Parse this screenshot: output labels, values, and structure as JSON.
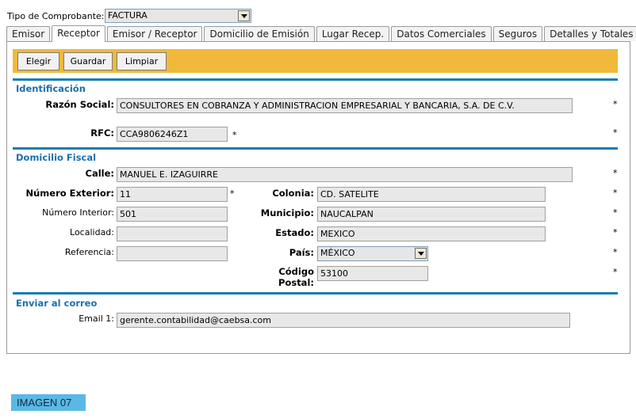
{
  "tipo": {
    "label": "Tipo de Comprobante:",
    "value": "FACTURA"
  },
  "tabs": [
    "Emisor",
    "Receptor",
    "Emisor / Receptor",
    "Domicilio de Emisión",
    "Lugar Recep.",
    "Datos Comerciales",
    "Seguros",
    "Detalles y Totales"
  ],
  "toolbar": {
    "elegir": "Elegir",
    "guardar": "Guardar",
    "limpiar": "Limpiar"
  },
  "sections": {
    "identificacion": "Identificación",
    "domicilio": "Domicilio Fiscal",
    "correo": "Enviar al correo"
  },
  "required_mark": "*",
  "identificacion": {
    "razon_social_label": "Razón Social:",
    "razon_social": "CONSULTORES EN COBRANZA Y ADMINISTRACION EMPRESARIAL Y BANCARIA, S.A. DE C.V.",
    "rfc_label": "RFC:",
    "rfc": "CCA9806246Z1"
  },
  "domicilio": {
    "calle_label": "Calle:",
    "calle": "MANUEL E. IZAGUIRRE",
    "num_ext_label": "Número Exterior:",
    "num_ext": "11",
    "num_int_label": "Número Interior:",
    "num_int": "501",
    "localidad_label": "Localidad:",
    "localidad": "",
    "referencia_label": "Referencia:",
    "referencia": "",
    "colonia_label": "Colonia:",
    "colonia": "CD. SATELITE",
    "municipio_label": "Municipio:",
    "municipio": "NAUCALPAN",
    "estado_label": "Estado:",
    "estado": "MEXICO",
    "pais_label": "País:",
    "pais": "MÉXICO",
    "cp_label_1": "Código",
    "cp_label_2": "Postal:",
    "cp": "53100"
  },
  "correo": {
    "email1_label": "Email 1:",
    "email1": "gerente.contabilidad@caebsa.com"
  },
  "caption": "IMAGEN 07",
  "colors": {
    "toolbar": "#f0b93b",
    "section": "#1a6fae",
    "divider": "#1a7db0",
    "badge": "#5bb8e6"
  }
}
